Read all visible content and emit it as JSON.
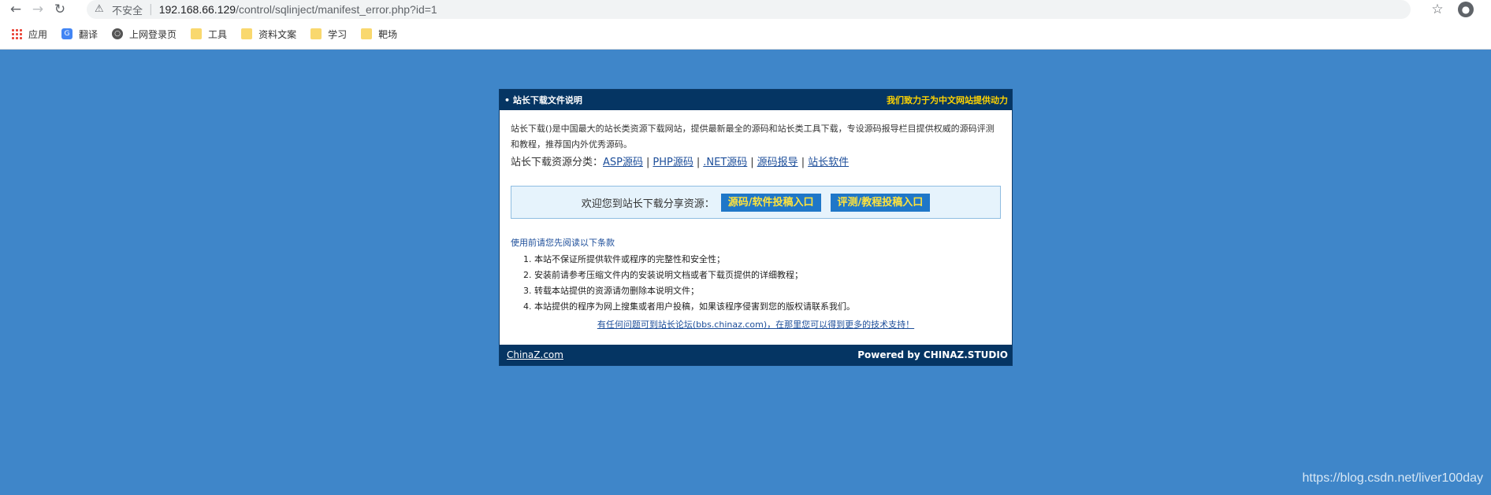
{
  "browser": {
    "insecure_label": "不安全",
    "url_host": "192.168.66.129",
    "url_path": "/control/sqlinject/manifest_error.php?id=1",
    "bookmarks": [
      {
        "label": "应用",
        "icon": "apps-icon"
      },
      {
        "label": "翻译",
        "icon": "translate-icon"
      },
      {
        "label": "上网登录页",
        "icon": "globe-icon"
      },
      {
        "label": "工具",
        "icon": "folder-icon"
      },
      {
        "label": "资料文案",
        "icon": "folder-icon"
      },
      {
        "label": "学习",
        "icon": "folder-icon"
      },
      {
        "label": "靶场",
        "icon": "folder-icon"
      }
    ]
  },
  "panel": {
    "header_left": "• 站长下载文件说明",
    "header_right": "我们致力于为中文网站提供动力",
    "intro": "站长下载()是中国最大的站长类资源下载网站，提供最新最全的源码和站长类工具下载，专设源码报导栏目提供权威的源码评测和教程，推荐国内外优秀源码。",
    "categories_label": "站长下载资源分类：",
    "categories": [
      "ASP源码",
      "PHP源码",
      ".NET源码",
      "源码报导",
      "站长软件"
    ],
    "category_separator": "|",
    "share_label": "欢迎您到站长下载分享资源：",
    "share_buttons": [
      "源码/软件投稿入口",
      "评测/教程投稿入口"
    ],
    "terms_title": "使用前请您先阅读以下条款",
    "terms": [
      "本站不保证所提供软件或程序的完整性和安全性；",
      "安装前请参考压缩文件内的安装说明文档或者下载页提供的详细教程；",
      "转载本站提供的资源请勿删除本说明文件；",
      "本站提供的程序为网上搜集或者用户投稿，如果该程序侵害到您的版权请联系我们。"
    ],
    "forum_link": "有任何问题可到站长论坛(bbs.chinaz.com)，在那里您可以得到更多的技术支持！",
    "footer_left": "ChinaZ.com",
    "footer_right": "Powered by CHINAZ.STUDIO"
  },
  "watermark": "https://blog.csdn.net/liver100day",
  "colors": {
    "page_bg": "#3f86c9",
    "header_bg": "#053563",
    "header_accent": "#ffd300",
    "button_bg": "#1f77c8",
    "button_text": "#ffe33d",
    "link": "#1d4e9a"
  }
}
